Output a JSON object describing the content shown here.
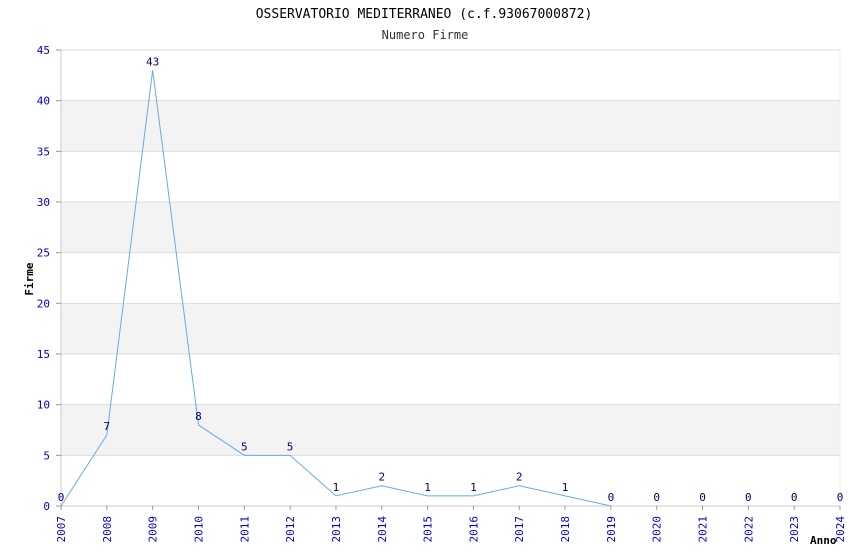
{
  "chart_data": {
    "type": "line",
    "title": "OSSERVATORIO MEDITERRANEO (c.f.93067000872)",
    "subtitle": "Numero Firme",
    "xlabel": "Anno",
    "ylabel": "Firme",
    "categories": [
      "2007",
      "2008",
      "2009",
      "2010",
      "2011",
      "2012",
      "2013",
      "2014",
      "2015",
      "2016",
      "2017",
      "2018",
      "2019",
      "2020",
      "2021",
      "2022",
      "2023",
      "2024"
    ],
    "series": [
      {
        "values": [
          0,
          7,
          43,
          8,
          5,
          5,
          1,
          2,
          1,
          1,
          2,
          1,
          0,
          null,
          null,
          null,
          null,
          null
        ]
      }
    ],
    "labels": [
      "0",
      "7",
      "43",
      "8",
      "5",
      "5",
      "1",
      "2",
      "1",
      "1",
      "2",
      "1",
      "0",
      "0",
      "0",
      "0",
      "0",
      "0"
    ],
    "ylim": [
      0,
      45
    ],
    "yticks": [
      0,
      5,
      10,
      15,
      20,
      25,
      30,
      35,
      40,
      45
    ],
    "grid": true,
    "colors": {
      "line": "#66aaee",
      "band": "#f3f3f3",
      "grid": "#dddddd",
      "tick": "#0000cc"
    }
  }
}
